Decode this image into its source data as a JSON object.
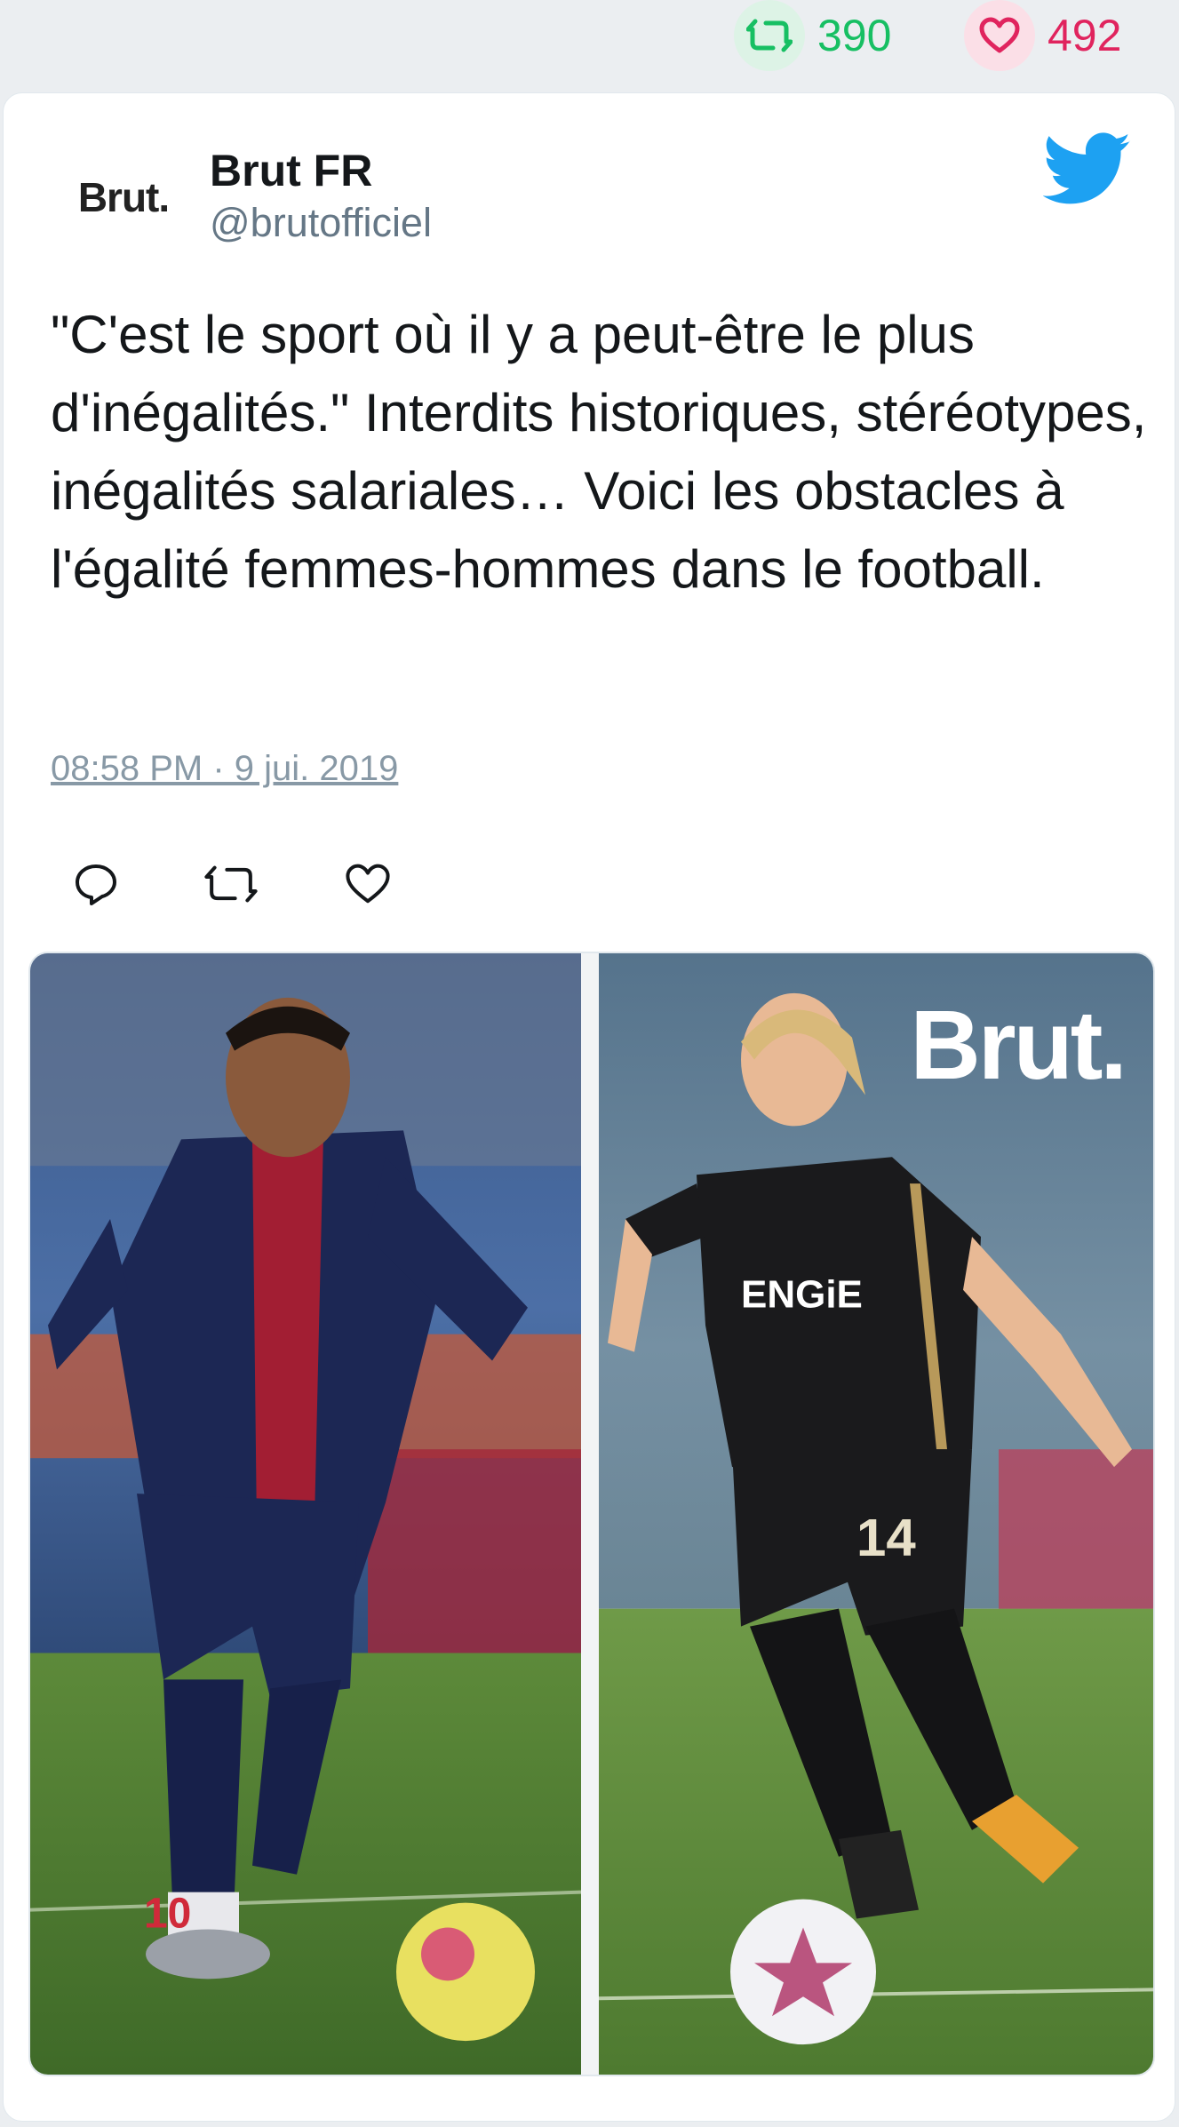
{
  "stats": {
    "retweets": "390",
    "likes": "492"
  },
  "author": {
    "avatar_text": "Brut.",
    "name": "Brut FR",
    "handle": "@brutofficiel"
  },
  "tweet": {
    "text": "\"C'est le sport où il y a peut-être le plus d'inégalités.\" Interdits historiques, stéréotypes, inégalités salariales… Voici les obstacles à l'égalité femmes-hommes dans le football.",
    "timestamp": "08:58 PM · 9 jui. 2019"
  },
  "media": {
    "watermark": "Brut.",
    "left_jersey_number": "10",
    "right_jersey_number": "14",
    "right_sponsor": "ENGiE"
  },
  "colors": {
    "retweet": "#17bf63",
    "like": "#e0245e",
    "twitter_blue": "#1da1f2",
    "text": "#14171a",
    "muted": "#657786"
  },
  "icons": {
    "retweet_stat": "retweet-icon",
    "like_stat": "heart-icon",
    "brand": "twitter-bird-icon",
    "reply": "reply-icon",
    "retweet": "retweet-icon",
    "like": "heart-icon"
  }
}
